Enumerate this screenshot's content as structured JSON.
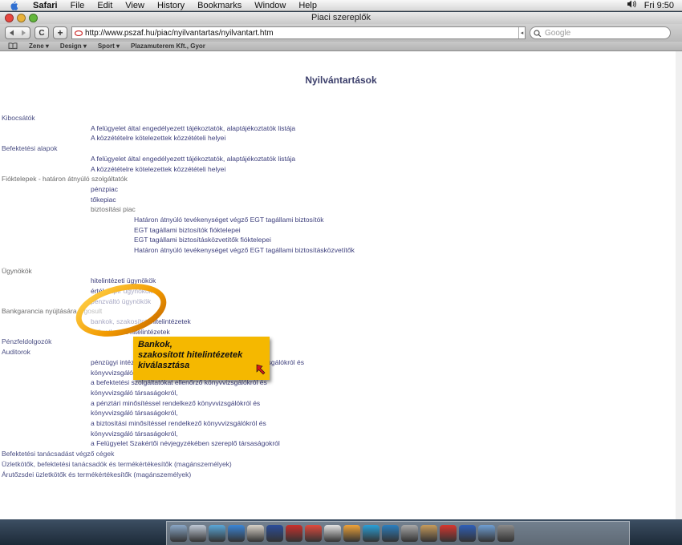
{
  "menubar": {
    "app_name": "Safari",
    "items": [
      "File",
      "Edit",
      "View",
      "History",
      "Bookmarks",
      "Window",
      "Help"
    ],
    "clock": "Fri 9:50"
  },
  "window": {
    "title": "Piaci szereplők"
  },
  "toolbar": {
    "url": "http://www.pszaf.hu/piac/nyilvantartas/nyilvantart.htm",
    "search_placeholder": "Google",
    "reload_glyph": "C",
    "add_glyph": "+"
  },
  "bookmarks": [
    "Zene",
    "Design",
    "Sport",
    "Plazamuterem Kft., Gyor"
  ],
  "page": {
    "title": "Nyilvántartások",
    "rows": [
      {
        "text": "Kibocsátók",
        "level": 0,
        "type": "sec"
      },
      {
        "text": "A felügyelet által engedélyezett tájékoztatók, alaptájékoztatók listája",
        "level": 1,
        "type": "link"
      },
      {
        "text": "A közzétételre kötelezettek közzétételi helyei",
        "level": 1,
        "type": "link"
      },
      {
        "text": "Befektetési alapok",
        "level": 0,
        "type": "sec"
      },
      {
        "text": "A felügyelet által engedélyezett tájékoztatók, alaptájékoztatók listája",
        "level": 1,
        "type": "link"
      },
      {
        "text": "A közzétételre kötelezettek közzétételi helyei",
        "level": 1,
        "type": "link"
      },
      {
        "text": "Fióktelepek - határon átnyúló szolgáltatók",
        "level": 0,
        "type": "dim"
      },
      {
        "text": "pénzpiac",
        "level": 1,
        "type": "link"
      },
      {
        "text": "tőkepiac",
        "level": 1,
        "type": "link"
      },
      {
        "text": "biztosítási piac",
        "level": 1,
        "type": "dim"
      },
      {
        "text": "Határon átnyúló tevékenységet végző EGT tagállami biztosítók",
        "level": 2,
        "type": "link"
      },
      {
        "text": "EGT tagállami biztosítók fióktelepei",
        "level": 2,
        "type": "link"
      },
      {
        "text": "EGT tagállami biztosításközvetítők fióktelepei",
        "level": 2,
        "type": "link"
      },
      {
        "text": "Határon átnyúló tevékenységet végző EGT tagállami biztosításközvetítők",
        "level": 2,
        "type": "link"
      },
      {
        "text": "",
        "level": 0,
        "type": "gap"
      },
      {
        "text": "Ügynökök",
        "level": 0,
        "type": "dim"
      },
      {
        "text": "hitelintézeti ügynökök",
        "level": 1,
        "type": "link"
      },
      {
        "text": "értékpapír ügynökök",
        "level": 1,
        "type": "link"
      },
      {
        "text": "pénzváltó ügynökök",
        "level": 1,
        "type": "link"
      },
      {
        "text": "Bankgarancia nyújtására jogosult",
        "level": 0,
        "type": "dim"
      },
      {
        "text": "bankok, szakosított hitelintézetek",
        "level": 1,
        "type": "link"
      },
      {
        "text": "szövetkezeti hitelintézetek",
        "level": 1,
        "type": "link"
      },
      {
        "text": "Pénzfeldolgozók",
        "level": 0,
        "type": "sec"
      },
      {
        "text": "Auditorok",
        "level": 0,
        "type": "sec"
      },
      {
        "text": "pénzügyi intézmények könyvvizsgálatára jogosult könyvvizsgálókról és",
        "level": 1,
        "type": "link"
      },
      {
        "text": "könyvvizsgáló társaságokról,",
        "level": 1,
        "type": "link"
      },
      {
        "text": "a befektetési szolgáltatókat ellenőrző könyvvizsgálókról és",
        "level": 1,
        "type": "link"
      },
      {
        "text": "könyvvizsgáló társaságokról,",
        "level": 1,
        "type": "link"
      },
      {
        "text": "a pénztári minősítéssel rendelkező könyvvizsgálókról és",
        "level": 1,
        "type": "link"
      },
      {
        "text": "könyvvizsgáló társaságokról,",
        "level": 1,
        "type": "link"
      },
      {
        "text": "a biztosítási minősítéssel rendelkező könyvvizsgálókról és",
        "level": 1,
        "type": "link"
      },
      {
        "text": "könyvvizsgáló társaságokról,",
        "level": 1,
        "type": "link"
      },
      {
        "text": "a Felügyelet Szakértői névjegyzékében szereplő társaságokról",
        "level": 1,
        "type": "link"
      },
      {
        "text": "Befektetési tanácsadást végző cégek",
        "level": 0,
        "type": "sec"
      },
      {
        "text": "Üzletkötők, befektetési tanácsadók és termékértékesítők (magánszemélyek)",
        "level": 0,
        "type": "sec"
      },
      {
        "text": "Árutőzsdei üzletkötők és termékértékesítők (magánszemélyek)",
        "level": 0,
        "type": "sec"
      }
    ]
  },
  "callout": {
    "text": "Bankok, szakosított hitelintézetek kiválasztása"
  },
  "dock_icons": [
    "finder-icon",
    "iphoto-icon",
    "itunes-icon",
    "safari-icon",
    "mail-icon",
    "word-icon",
    "acrobat-icon",
    "pdf-icon",
    "ical-icon",
    "flower-icon",
    "flash-icon",
    "quill-icon",
    "tools-icon",
    "package-icon",
    "flash2-icon",
    "word2-icon",
    "finder2-icon",
    "trash-icon"
  ],
  "colors": {
    "link": "#3d3f7c",
    "callout": "#f5b800",
    "ring": "#f0a000"
  }
}
